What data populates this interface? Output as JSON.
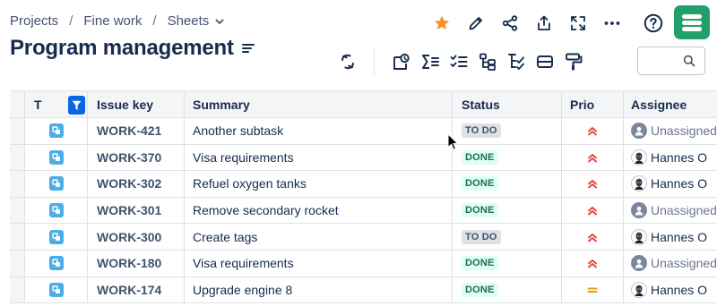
{
  "breadcrumb": {
    "items": [
      "Projects",
      "Fine work",
      "Sheets"
    ],
    "separator": "/"
  },
  "page_title": "Program management",
  "top_actions": [
    "star-icon",
    "edit-icon",
    "share-icon",
    "export-icon",
    "fullscreen-icon",
    "more-icon",
    "help-icon"
  ],
  "toolbar": {
    "icons": [
      "refresh-icon",
      "shape-icon",
      "sum-icon",
      "checklist-icon",
      "hierarchy-icon",
      "tree-check-icon",
      "card-icon",
      "paint-roller-icon"
    ],
    "search": {
      "value": "",
      "placeholder": ""
    }
  },
  "colors": {
    "accent": "#0c66e4",
    "star": "#f79232",
    "logo": "#22a06b",
    "done_bg": "#dcfff1",
    "done_fg": "#216e4e",
    "todo_bg": "#dfe1e6",
    "prio_high": "#e2483d",
    "prio_medium": "#e6a00f",
    "story_icon": "#4bade8"
  },
  "table": {
    "columns": {
      "type": "T",
      "key": "Issue key",
      "summary": "Summary",
      "status": "Status",
      "priority": "Prio",
      "assignee": "Assignee"
    },
    "rows": [
      {
        "key": "WORK-421",
        "summary": "Another subtask",
        "status": "TO DO",
        "status_kind": "todo",
        "priority": "high",
        "assignee": "Unassigned",
        "assignee_kind": "unassigned"
      },
      {
        "key": "WORK-370",
        "summary": "Visa requirements",
        "status": "DONE",
        "status_kind": "done",
        "priority": "high",
        "assignee": "Hannes O",
        "assignee_kind": "person"
      },
      {
        "key": "WORK-302",
        "summary": "Refuel oxygen tanks",
        "status": "DONE",
        "status_kind": "done",
        "priority": "high",
        "assignee": "Hannes O",
        "assignee_kind": "person"
      },
      {
        "key": "WORK-301",
        "summary": "Remove secondary rocket",
        "status": "DONE",
        "status_kind": "done",
        "priority": "high",
        "assignee": "Unassigned",
        "assignee_kind": "unassigned"
      },
      {
        "key": "WORK-300",
        "summary": "Create tags",
        "status": "TO DO",
        "status_kind": "todo",
        "priority": "high",
        "assignee": "Hannes O",
        "assignee_kind": "person"
      },
      {
        "key": "WORK-180",
        "summary": "Visa requirements",
        "status": "DONE",
        "status_kind": "done",
        "priority": "high",
        "assignee": "Unassigned",
        "assignee_kind": "unassigned"
      },
      {
        "key": "WORK-174",
        "summary": "Upgrade engine 8",
        "status": "DONE",
        "status_kind": "done",
        "priority": "medium",
        "assignee": "Hannes O",
        "assignee_kind": "person"
      }
    ]
  }
}
